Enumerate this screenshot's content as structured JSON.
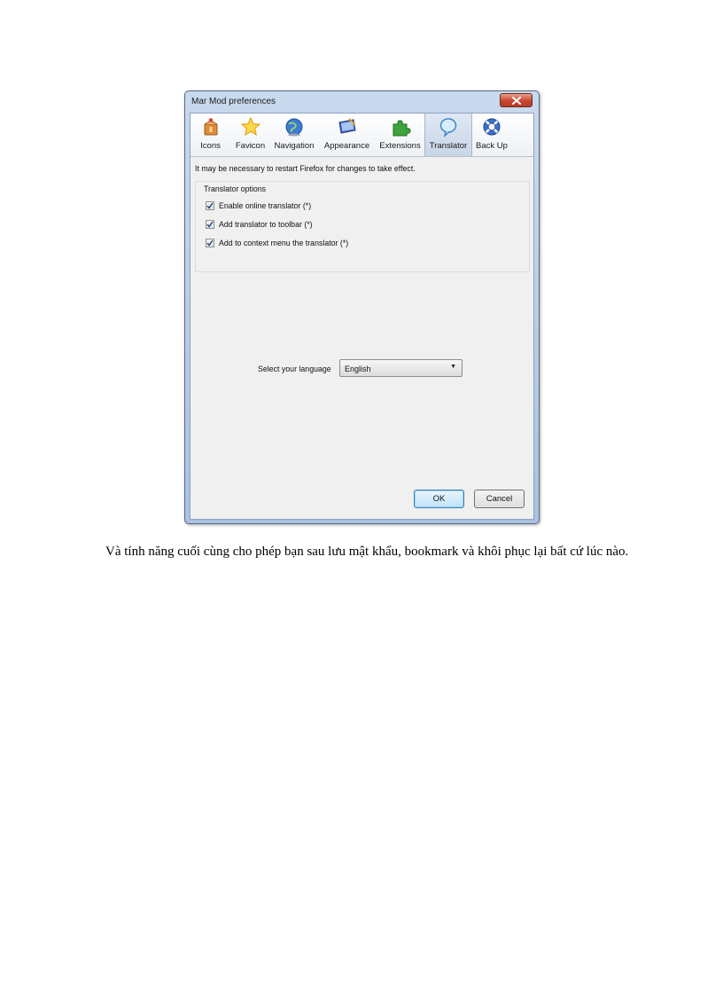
{
  "dialog": {
    "title": "Mar Mod preferences",
    "tabs": [
      {
        "label": "Icons",
        "icon": "icons-box-icon"
      },
      {
        "label": "Favicon",
        "icon": "star-icon"
      },
      {
        "label": "Navigation",
        "icon": "navigation-globe-icon"
      },
      {
        "label": "Appearance",
        "icon": "appearance-monitor-icon"
      },
      {
        "label": "Extensions",
        "icon": "puzzle-piece-icon"
      },
      {
        "label": "Translator",
        "icon": "speech-bubble-icon"
      },
      {
        "label": "Back Up",
        "icon": "lifebuoy-icon"
      }
    ],
    "selected_tab": "Translator",
    "restart_note": "It may be necessary to restart Firefox for changes to take effect.",
    "group_title": "Translator options",
    "options": [
      {
        "label": "Enable online translator (*)",
        "checked": true
      },
      {
        "label": "Add translator to toolbar (*)",
        "checked": true
      },
      {
        "label": "Add to context menu the translator (*)",
        "checked": true
      }
    ],
    "language_label": "Select your language",
    "language_value": "English",
    "ok_label": "OK",
    "cancel_label": "Cancel",
    "colors": {
      "title_bar": "#b8cfe9",
      "close_button": "#c8452f",
      "panel": "#f0f0f0"
    }
  },
  "caption": "Và tính năng cuối cùng cho phép bạn sau lưu mật khẩu, bookmark và khôi phục lại bất cứ lúc nào."
}
